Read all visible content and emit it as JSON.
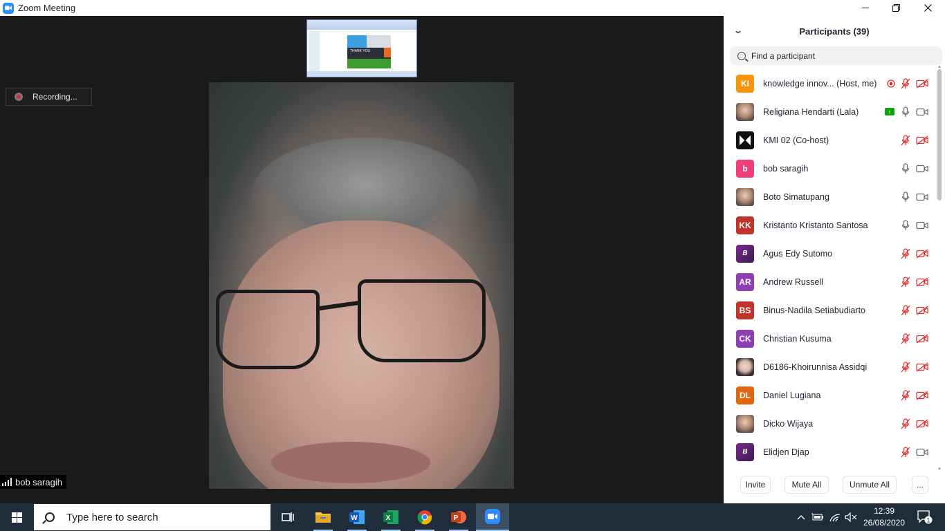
{
  "window": {
    "title": "Zoom Meeting",
    "minimize_symbol": "—",
    "maximize_symbol": "❐",
    "close_symbol": "✕"
  },
  "meeting": {
    "recording_label": "Recording...",
    "active_speaker": "bob saragih",
    "shared_slide_text": "THANK YOU"
  },
  "participants_panel": {
    "title": "Participants (39)",
    "search_placeholder": "Find a participant",
    "participants": [
      {
        "initials": "KI",
        "name": "knowledge innov... (Host, me)",
        "avatar_color": "#f7930f",
        "avatar_type": "initials",
        "mic": "muted",
        "video": "off",
        "recording": true
      },
      {
        "initials": "",
        "name": "Religiana Hendarti (Lala)",
        "avatar_type": "photo",
        "mic": "on",
        "video": "on",
        "sharing": true
      },
      {
        "initials": "",
        "name": "KMI 02 (Co-host)",
        "avatar_type": "logo",
        "mic": "muted",
        "video": "off"
      },
      {
        "initials": "b",
        "name": "bob saragih",
        "avatar_color": "#ef3f7b",
        "avatar_type": "initials",
        "mic": "on",
        "video": "on"
      },
      {
        "initials": "",
        "name": "Boto Simatupang",
        "avatar_type": "photo",
        "mic": "on",
        "video": "on"
      },
      {
        "initials": "KK",
        "name": "Kristanto Kristanto Santosa",
        "avatar_color": "#c0342b",
        "avatar_type": "initials",
        "mic": "on",
        "video": "on"
      },
      {
        "initials": "B",
        "name": "Agus Edy Sutomo",
        "avatar_type": "binus",
        "mic": "muted",
        "video": "off"
      },
      {
        "initials": "AR",
        "name": "Andrew Russell",
        "avatar_color": "#8e3fb5",
        "avatar_type": "initials",
        "mic": "muted",
        "video": "off"
      },
      {
        "initials": "BS",
        "name": "Binus-Nadila Setiabudiarto",
        "avatar_color": "#c0342b",
        "avatar_type": "initials",
        "mic": "muted",
        "video": "off"
      },
      {
        "initials": "CK",
        "name": "Christian Kusuma",
        "avatar_color": "#8e3fb5",
        "avatar_type": "initials",
        "mic": "muted",
        "video": "off"
      },
      {
        "initials": "",
        "name": "D6186-Khoirunnisa Assidqi",
        "avatar_type": "photo2",
        "mic": "muted",
        "video": "off"
      },
      {
        "initials": "DL",
        "name": "Daniel Lugiana",
        "avatar_color": "#e06710",
        "avatar_type": "initials",
        "mic": "muted",
        "video": "off"
      },
      {
        "initials": "",
        "name": "Dicko Wijaya",
        "avatar_type": "photo",
        "mic": "muted",
        "video": "off"
      },
      {
        "initials": "B",
        "name": "Elidjen Djap",
        "avatar_type": "binus",
        "mic": "muted",
        "video": "on"
      }
    ],
    "footer_buttons": [
      "Invite",
      "Mute All",
      "Unmute All",
      "..."
    ]
  },
  "taskbar": {
    "search_placeholder": "Type here to search",
    "apps": [
      "task-view",
      "file-explorer",
      "word",
      "excel",
      "chrome",
      "powerpoint",
      "zoom"
    ],
    "time": "12:39",
    "date": "26/08/2020",
    "notification_count": "1"
  },
  "colors": {
    "mute_red": "#e02828",
    "zoom_blue": "#2d8cff",
    "share_green": "#13a10e",
    "taskbar_bg": "#1f2d3a"
  }
}
